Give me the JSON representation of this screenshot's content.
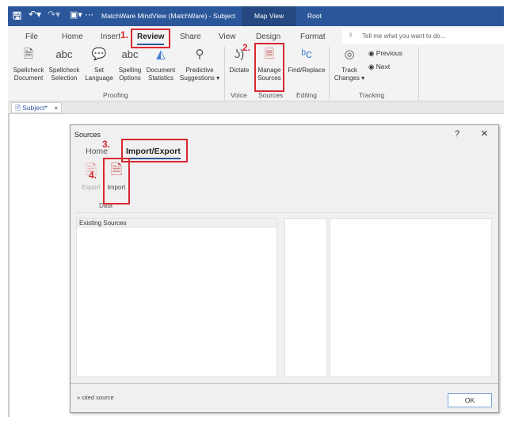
{
  "titlebar": {
    "title": "MatchWare MindView (MatchWare) - Subject",
    "tabs": [
      "Map View",
      "Root"
    ]
  },
  "ribbon": {
    "tabs": [
      "File",
      "Home",
      "Insert",
      "Review",
      "Share",
      "View",
      "Design",
      "Format"
    ],
    "active_tab": "Review",
    "search_placeholder": "Tell me what you want to do...",
    "buttons": [
      {
        "l1": "Spellcheck",
        "l2": "Document",
        "icon": "spellcheck-document-icon"
      },
      {
        "l1": "Spellcheck",
        "l2": "Selection",
        "icon": "abc-check-icon"
      },
      {
        "l1": "Set",
        "l2": "Language",
        "icon": "language-icon"
      },
      {
        "l1": "Spelling",
        "l2": "Options",
        "icon": "abc-gear-icon"
      },
      {
        "l1": "Document",
        "l2": "Statistics",
        "icon": "statistics-icon"
      },
      {
        "l1": "Predictive",
        "l2": "Suggestions ▾",
        "icon": "predictive-icon"
      },
      {
        "l1": "Dictate",
        "l2": "",
        "icon": "microphone-icon"
      },
      {
        "l1": "Manage",
        "l2": "Sources",
        "icon": "manage-sources-icon"
      },
      {
        "l1": "Find/Replace",
        "l2": "",
        "icon": "find-replace-icon"
      },
      {
        "l1": "Track",
        "l2": "Changes ▾",
        "icon": "track-changes-icon"
      }
    ],
    "small_buttons": [
      "Previous",
      "Next"
    ],
    "groups": [
      "Proofing",
      "Voice",
      "Sources",
      "Editing",
      "Tracking"
    ]
  },
  "annotations": [
    "1.",
    "2.",
    "3.",
    "4."
  ],
  "doc_tab": {
    "label": "Subject*",
    "close": "×"
  },
  "dialog": {
    "title": "Sources",
    "help": "?",
    "close": "×",
    "tabs": [
      "Home",
      "Import/Export"
    ],
    "active_tab": "Import/Export",
    "buttons": [
      "Export",
      "Import"
    ],
    "group": "Data",
    "list_header": "Existing Sources",
    "footer_text": "» cited source",
    "ok": "OK"
  },
  "colors": {
    "titlebar": "#2b579a",
    "annotation": "#d9282f",
    "active_underline": "#2b579a"
  }
}
